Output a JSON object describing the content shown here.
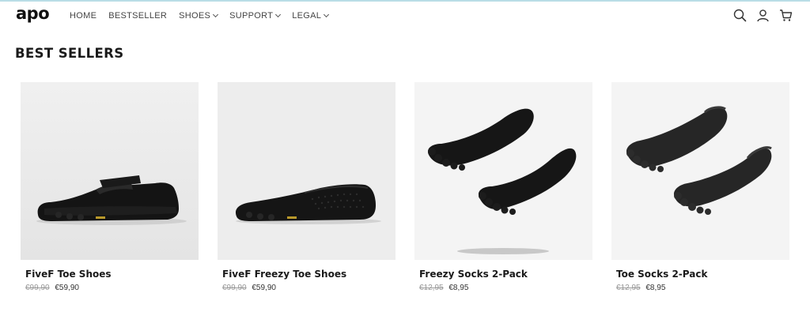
{
  "header": {
    "logo": "apo",
    "nav": [
      {
        "label": "HOME",
        "dropdown": false
      },
      {
        "label": "BESTSELLER",
        "dropdown": false
      },
      {
        "label": "SHOES",
        "dropdown": true
      },
      {
        "label": "SUPPORT",
        "dropdown": true
      },
      {
        "label": "LEGAL",
        "dropdown": true
      }
    ],
    "icons": [
      "search-icon",
      "account-icon",
      "cart-icon"
    ]
  },
  "section": {
    "title": "BEST SELLERS"
  },
  "products": [
    {
      "name": "FiveF Toe Shoes",
      "old_price": "€99,90",
      "price": "€59,90",
      "image": "strap-toe-shoe"
    },
    {
      "name": "FiveF Freezy Toe Shoes",
      "old_price": "€99,90",
      "price": "€59,90",
      "image": "mesh-toe-shoe"
    },
    {
      "name": "Freezy Socks 2-Pack",
      "old_price": "€12,95",
      "price": "€8,95",
      "image": "black-toe-socks"
    },
    {
      "name": "Toe Socks 2-Pack",
      "old_price": "€12,95",
      "price": "€8,95",
      "image": "grey-toe-socks"
    }
  ]
}
